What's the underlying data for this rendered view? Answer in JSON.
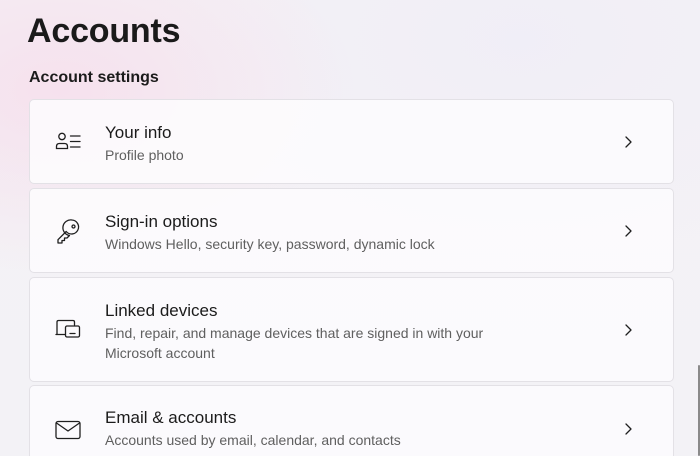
{
  "page": {
    "title": "Accounts",
    "section_title": "Account settings"
  },
  "items": [
    {
      "title": "Your info",
      "subtitle": "Profile photo",
      "icon": "person-info-icon"
    },
    {
      "title": "Sign-in options",
      "subtitle": "Windows Hello, security key, password, dynamic lock",
      "icon": "key-icon"
    },
    {
      "title": "Linked devices",
      "subtitle": "Find, repair, and manage devices that are signed in with your Microsoft account",
      "icon": "devices-icon"
    },
    {
      "title": "Email & accounts",
      "subtitle": "Accounts used by email, calendar, and contacts",
      "icon": "mail-icon"
    }
  ],
  "colors": {
    "background": "#f3f1f5",
    "card": "#fcfbfd",
    "card_border": "#e3e1e6",
    "text_primary": "#1b1b1b",
    "text_secondary": "#5f5f5f"
  }
}
